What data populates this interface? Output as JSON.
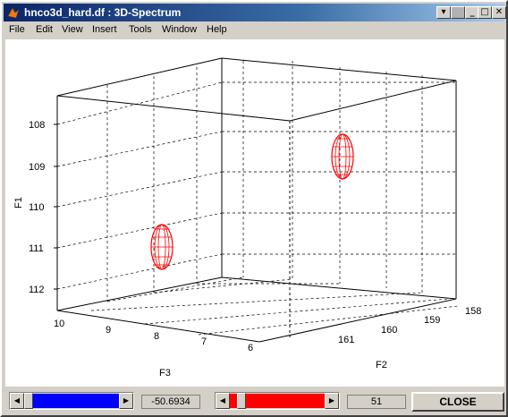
{
  "window": {
    "title": "hnco3d_hard.df : 3D-Spectrum",
    "controls": {
      "special": "▾",
      "minimize": "_",
      "maximize": "□",
      "close": "✕"
    }
  },
  "menu": [
    "File",
    "Edit",
    "View",
    "Insert",
    "Tools",
    "Window",
    "Help"
  ],
  "plot": {
    "ylabel": "F1",
    "xlabel": "F3",
    "zlabel": "F2",
    "f1_ticks": [
      "108",
      "109",
      "110",
      "111",
      "112"
    ],
    "f3_ticks": [
      "10",
      "9",
      "8",
      "7",
      "6"
    ],
    "f2_ticks": [
      "158",
      "159",
      "160",
      "161"
    ],
    "peak_color": "#ff0000"
  },
  "controls": {
    "left_slider_color": "#0000ff",
    "left_value": "-50.6934",
    "right_slider_color": "#ff0000",
    "right_value": "51",
    "close_label": "CLOSE"
  }
}
